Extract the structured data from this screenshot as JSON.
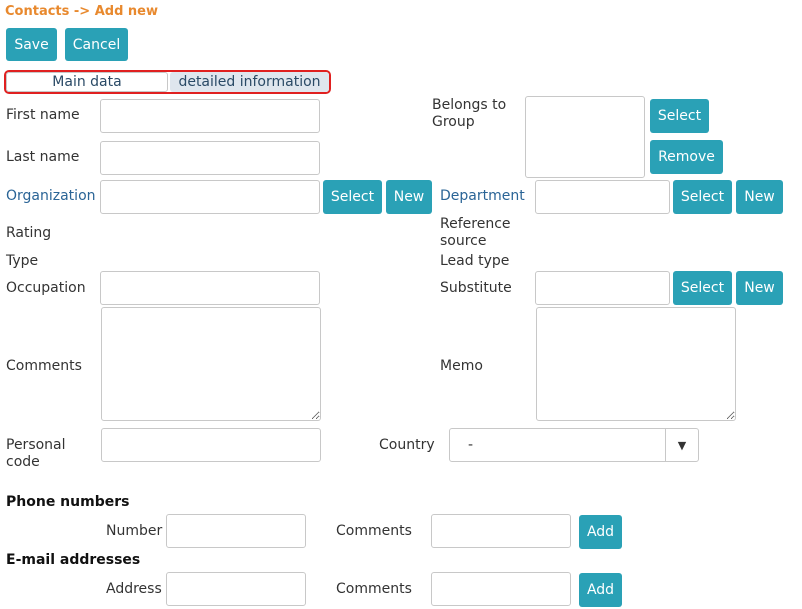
{
  "breadcrumb": "Contacts -> Add new",
  "toolbar": {
    "save_label": "Save",
    "cancel_label": "Cancel"
  },
  "tabs": [
    {
      "label": "Main data",
      "active": true
    },
    {
      "label": "detailed information",
      "active": false
    }
  ],
  "fields": {
    "first_name": "First name",
    "last_name": "Last name",
    "organization": "Organization",
    "rating": "Rating",
    "type": "Type",
    "occupation": "Occupation",
    "comments": "Comments",
    "personal_code": "Personal code",
    "belongs_to_group": "Belongs to Group",
    "department": "Department",
    "reference_source": "Reference source",
    "lead_type": "Lead type",
    "substitute": "Substitute",
    "memo": "Memo",
    "country": "Country"
  },
  "buttons": {
    "select": "Select",
    "new": "New",
    "remove": "Remove",
    "add": "Add"
  },
  "country_select": {
    "value": "-",
    "arrow": "▼"
  },
  "phone_section": {
    "title": "Phone numbers",
    "number_label": "Number",
    "comments_label": "Comments"
  },
  "email_section": {
    "title": "E-mail addresses",
    "address_label": "Address",
    "comments_label": "Comments"
  },
  "colors": {
    "accent": "#2aa1b6",
    "breadcrumb": "#e8892e",
    "link": "#2a6496",
    "tab_highlight": "#e02020"
  }
}
